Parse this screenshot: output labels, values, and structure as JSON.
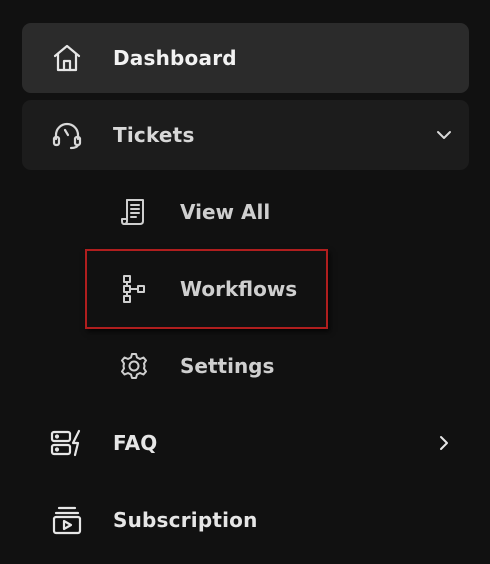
{
  "colors": {
    "background": "#111111",
    "active_bg": "#2b2b2b",
    "expanded_bg": "#1c1c1c",
    "text": "#e6e6e6",
    "highlight_border": "#b01e1e"
  },
  "nav": {
    "dashboard": {
      "label": "Dashboard",
      "icon": "home-icon"
    },
    "tickets": {
      "label": "Tickets",
      "icon": "headset-icon",
      "chevron": "chevron-down-icon",
      "children": {
        "view_all": {
          "label": "View All",
          "icon": "receipt-icon"
        },
        "workflows": {
          "label": "Workflows",
          "icon": "workflow-icon"
        },
        "settings": {
          "label": "Settings",
          "icon": "gear-icon"
        }
      }
    },
    "faq": {
      "label": "FAQ",
      "icon": "faq-icon",
      "chevron": "chevron-right-icon"
    },
    "subscription": {
      "label": "Subscription",
      "icon": "subscription-icon"
    }
  }
}
